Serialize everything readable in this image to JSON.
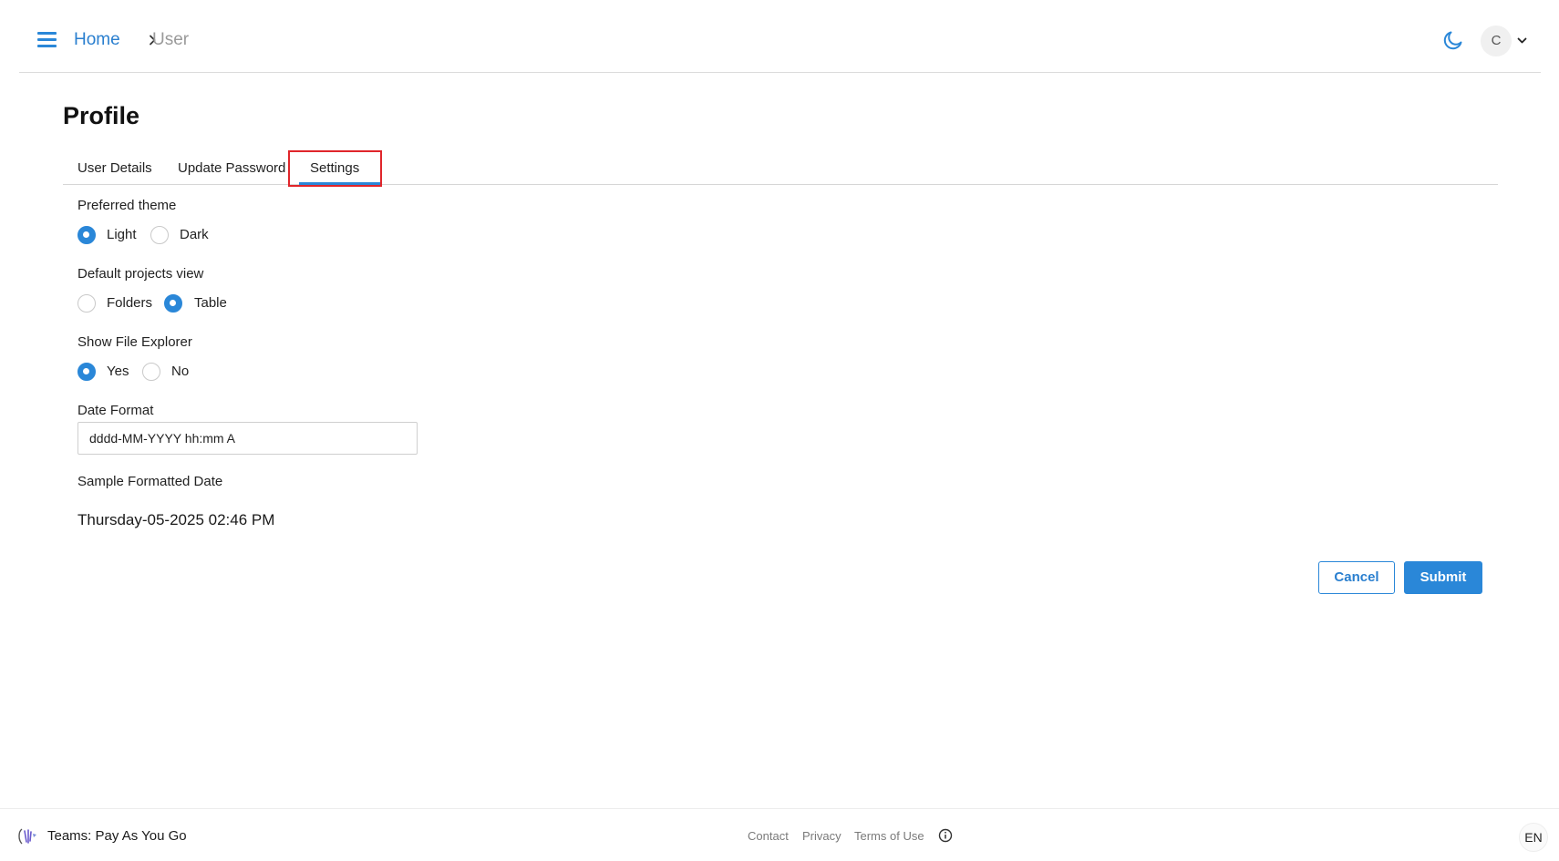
{
  "header": {
    "breadcrumb": {
      "home": "Home",
      "current": "User"
    },
    "avatar_initial": "C",
    "accent_color": "#2a87d8"
  },
  "page": {
    "title": "Profile"
  },
  "tabs": [
    {
      "label": "User Details",
      "active": false
    },
    {
      "label": "Update Password",
      "active": false
    },
    {
      "label": "Settings",
      "active": true
    }
  ],
  "settings": {
    "theme": {
      "label": "Preferred theme",
      "options": [
        "Light",
        "Dark"
      ],
      "selected": "Light"
    },
    "projects_view": {
      "label": "Default projects view",
      "options": [
        "Folders",
        "Table"
      ],
      "selected": "Table"
    },
    "file_explorer": {
      "label": "Show File Explorer",
      "options": [
        "Yes",
        "No"
      ],
      "selected": "Yes"
    },
    "date_format": {
      "label": "Date Format",
      "value": "dddd-MM-YYYY hh:mm A"
    },
    "sample": {
      "label": "Sample Formatted Date",
      "value": "Thursday-05-2025 02:46 PM"
    }
  },
  "actions": {
    "cancel": "Cancel",
    "submit": "Submit"
  },
  "footer": {
    "plan": "Teams: Pay As You Go",
    "links": [
      "Contact",
      "Privacy",
      "Terms of Use"
    ],
    "language": "EN"
  }
}
